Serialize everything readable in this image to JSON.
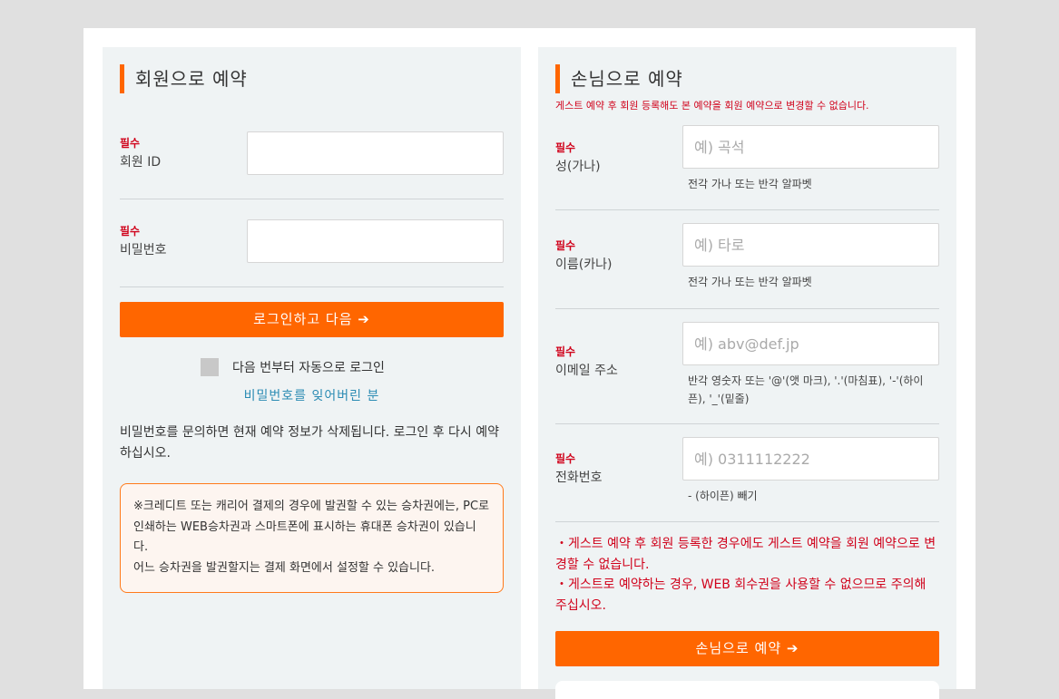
{
  "member": {
    "title": "회원으로 예약",
    "required": "필수",
    "id_label": "회원 ID",
    "id_value": "",
    "password_label": "비밀번호",
    "password_value": "",
    "login_button": "로그인하고 다음 ➔",
    "auto_login": "다음 번부터 자동으로 로그인",
    "forgot_password": "비밀번호를 잊어버린 분",
    "info": "비밀번호를 문의하면 현재 예약 정보가 삭제됩니다. 로그인 후 다시 예약하십시오.",
    "notice": [
      "※크레디트 또는 캐리어 결제의 경우에 발권할 수 있는 승차권에는, PC로 인쇄하는 WEB승차권과 스마트폰에 표시하는 휴대폰 승차권이 있습니다.",
      "어느 승차권을 발권할지는 결제 화면에서 설정할 수 있습니다."
    ]
  },
  "guest": {
    "title": "손님으로 예약",
    "note": "게스트 예약 후 회원 등록해도 본 예약을 회원 예약으로 변경할 수 없습니다.",
    "required": "필수",
    "surname_label": "성(가나)",
    "surname_placeholder": "예) 곡석",
    "surname_hint": "전각 가나 또는 반각 알파벳",
    "name_label": "이름(카나)",
    "name_placeholder": "예) 타로",
    "name_hint": "전각 가나 또는 반각 알파벳",
    "email_label": "이메일 주소",
    "email_placeholder": "예) abv@def.jp",
    "email_hint": "반각 영숫자 또는 '@'(앳 마크), '.'(마침표), '-'(하이픈), '_'(밑줄)",
    "phone_label": "전화번호",
    "phone_placeholder": "예) 0311112222",
    "phone_hint": "- (하이픈) 빼기",
    "warnings": [
      "・게스트 예약 후 회원 등록한 경우에도 게스트 예약을 회원 예약으로 변경할 수 없습니다.",
      "・게스트로 예약하는 경우, WEB 회수권을 사용할 수 없으므로 주의해 주십시오."
    ],
    "submit_button": "손님으로 예약 ➔"
  },
  "colors": {
    "accent": "#ff6600",
    "required": "#d0021b",
    "link": "#2a8bb3",
    "panel": "#eff3f4"
  }
}
